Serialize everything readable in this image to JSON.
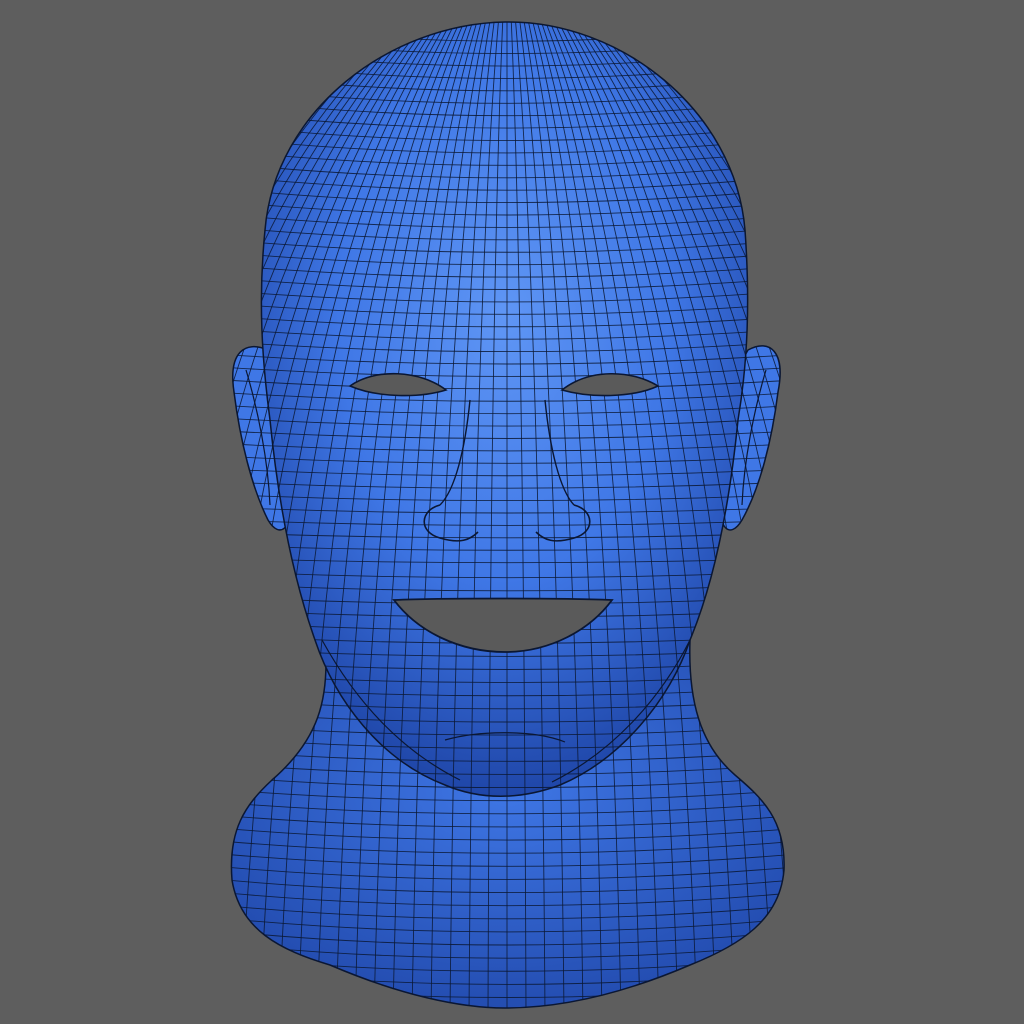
{
  "viewport": {
    "background_color": "#5e5e5e",
    "model": {
      "subject": "wireframe-head",
      "surface_color": "#3f77e6",
      "highlight_color": "#5f96f5",
      "shadow_color": "#1f46a8",
      "wire_color": "#0b1733",
      "cavity_color": "#5a5a5a"
    }
  }
}
